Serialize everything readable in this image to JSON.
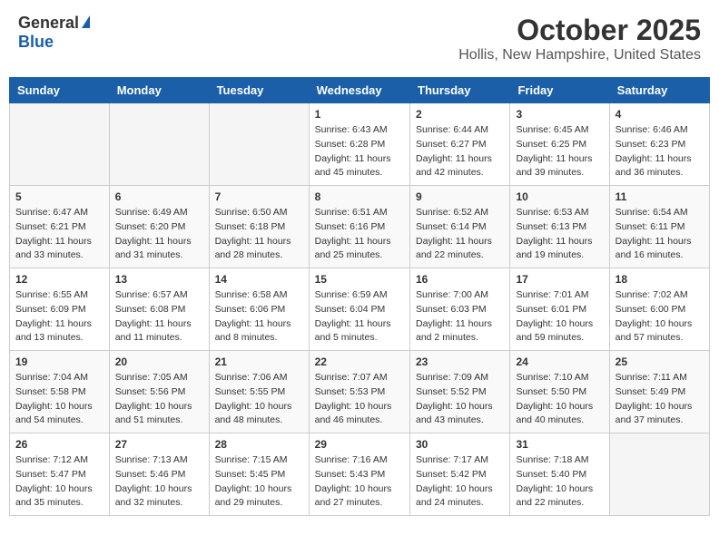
{
  "header": {
    "logo_general": "General",
    "logo_blue": "Blue",
    "month_title": "October 2025",
    "location": "Hollis, New Hampshire, United States"
  },
  "weekdays": [
    "Sunday",
    "Monday",
    "Tuesday",
    "Wednesday",
    "Thursday",
    "Friday",
    "Saturday"
  ],
  "weeks": [
    {
      "days": [
        {
          "num": "",
          "info": ""
        },
        {
          "num": "",
          "info": ""
        },
        {
          "num": "",
          "info": ""
        },
        {
          "num": "1",
          "info": "Sunrise: 6:43 AM\nSunset: 6:28 PM\nDaylight: 11 hours\nand 45 minutes."
        },
        {
          "num": "2",
          "info": "Sunrise: 6:44 AM\nSunset: 6:27 PM\nDaylight: 11 hours\nand 42 minutes."
        },
        {
          "num": "3",
          "info": "Sunrise: 6:45 AM\nSunset: 6:25 PM\nDaylight: 11 hours\nand 39 minutes."
        },
        {
          "num": "4",
          "info": "Sunrise: 6:46 AM\nSunset: 6:23 PM\nDaylight: 11 hours\nand 36 minutes."
        }
      ]
    },
    {
      "days": [
        {
          "num": "5",
          "info": "Sunrise: 6:47 AM\nSunset: 6:21 PM\nDaylight: 11 hours\nand 33 minutes."
        },
        {
          "num": "6",
          "info": "Sunrise: 6:49 AM\nSunset: 6:20 PM\nDaylight: 11 hours\nand 31 minutes."
        },
        {
          "num": "7",
          "info": "Sunrise: 6:50 AM\nSunset: 6:18 PM\nDaylight: 11 hours\nand 28 minutes."
        },
        {
          "num": "8",
          "info": "Sunrise: 6:51 AM\nSunset: 6:16 PM\nDaylight: 11 hours\nand 25 minutes."
        },
        {
          "num": "9",
          "info": "Sunrise: 6:52 AM\nSunset: 6:14 PM\nDaylight: 11 hours\nand 22 minutes."
        },
        {
          "num": "10",
          "info": "Sunrise: 6:53 AM\nSunset: 6:13 PM\nDaylight: 11 hours\nand 19 minutes."
        },
        {
          "num": "11",
          "info": "Sunrise: 6:54 AM\nSunset: 6:11 PM\nDaylight: 11 hours\nand 16 minutes."
        }
      ]
    },
    {
      "days": [
        {
          "num": "12",
          "info": "Sunrise: 6:55 AM\nSunset: 6:09 PM\nDaylight: 11 hours\nand 13 minutes."
        },
        {
          "num": "13",
          "info": "Sunrise: 6:57 AM\nSunset: 6:08 PM\nDaylight: 11 hours\nand 11 minutes."
        },
        {
          "num": "14",
          "info": "Sunrise: 6:58 AM\nSunset: 6:06 PM\nDaylight: 11 hours\nand 8 minutes."
        },
        {
          "num": "15",
          "info": "Sunrise: 6:59 AM\nSunset: 6:04 PM\nDaylight: 11 hours\nand 5 minutes."
        },
        {
          "num": "16",
          "info": "Sunrise: 7:00 AM\nSunset: 6:03 PM\nDaylight: 11 hours\nand 2 minutes."
        },
        {
          "num": "17",
          "info": "Sunrise: 7:01 AM\nSunset: 6:01 PM\nDaylight: 10 hours\nand 59 minutes."
        },
        {
          "num": "18",
          "info": "Sunrise: 7:02 AM\nSunset: 6:00 PM\nDaylight: 10 hours\nand 57 minutes."
        }
      ]
    },
    {
      "days": [
        {
          "num": "19",
          "info": "Sunrise: 7:04 AM\nSunset: 5:58 PM\nDaylight: 10 hours\nand 54 minutes."
        },
        {
          "num": "20",
          "info": "Sunrise: 7:05 AM\nSunset: 5:56 PM\nDaylight: 10 hours\nand 51 minutes."
        },
        {
          "num": "21",
          "info": "Sunrise: 7:06 AM\nSunset: 5:55 PM\nDaylight: 10 hours\nand 48 minutes."
        },
        {
          "num": "22",
          "info": "Sunrise: 7:07 AM\nSunset: 5:53 PM\nDaylight: 10 hours\nand 46 minutes."
        },
        {
          "num": "23",
          "info": "Sunrise: 7:09 AM\nSunset: 5:52 PM\nDaylight: 10 hours\nand 43 minutes."
        },
        {
          "num": "24",
          "info": "Sunrise: 7:10 AM\nSunset: 5:50 PM\nDaylight: 10 hours\nand 40 minutes."
        },
        {
          "num": "25",
          "info": "Sunrise: 7:11 AM\nSunset: 5:49 PM\nDaylight: 10 hours\nand 37 minutes."
        }
      ]
    },
    {
      "days": [
        {
          "num": "26",
          "info": "Sunrise: 7:12 AM\nSunset: 5:47 PM\nDaylight: 10 hours\nand 35 minutes."
        },
        {
          "num": "27",
          "info": "Sunrise: 7:13 AM\nSunset: 5:46 PM\nDaylight: 10 hours\nand 32 minutes."
        },
        {
          "num": "28",
          "info": "Sunrise: 7:15 AM\nSunset: 5:45 PM\nDaylight: 10 hours\nand 29 minutes."
        },
        {
          "num": "29",
          "info": "Sunrise: 7:16 AM\nSunset: 5:43 PM\nDaylight: 10 hours\nand 27 minutes."
        },
        {
          "num": "30",
          "info": "Sunrise: 7:17 AM\nSunset: 5:42 PM\nDaylight: 10 hours\nand 24 minutes."
        },
        {
          "num": "31",
          "info": "Sunrise: 7:18 AM\nSunset: 5:40 PM\nDaylight: 10 hours\nand 22 minutes."
        },
        {
          "num": "",
          "info": ""
        }
      ]
    }
  ]
}
